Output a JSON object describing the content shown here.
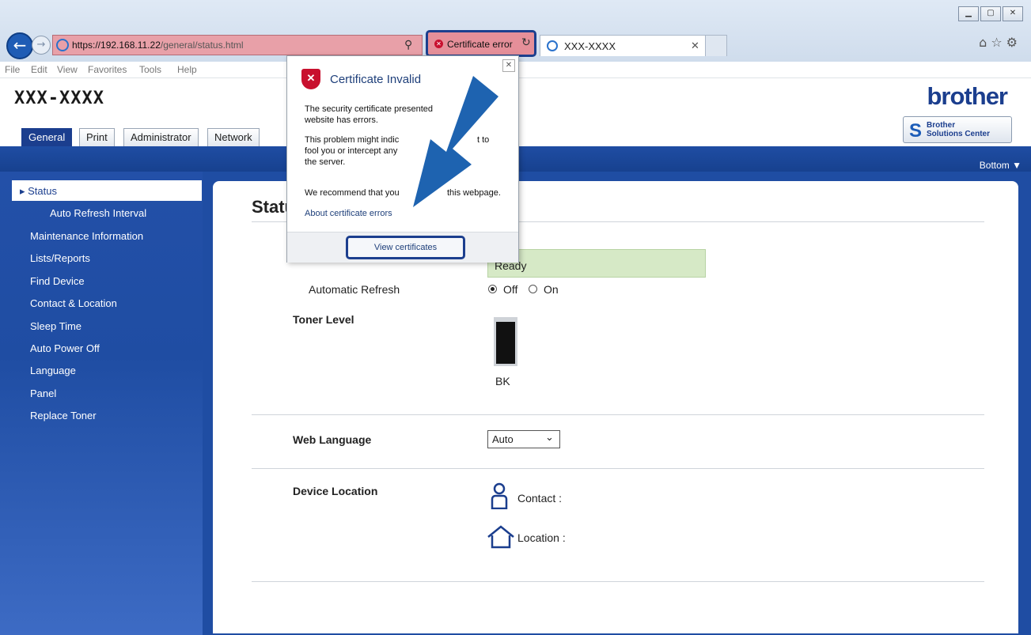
{
  "browser": {
    "url_host": "https://192.168.11.22",
    "url_path": "/general/status.html",
    "cert_error_label": "Certificate error",
    "tab_title": "XXX-XXXX",
    "menu": [
      "File",
      "Edit",
      "View",
      "Favorites",
      "Tools",
      "Help"
    ]
  },
  "header": {
    "page_title": "XXX-XXXX",
    "brand": "brother",
    "solutions_line1": "Brother",
    "solutions_line2": "Solutions Center",
    "tabs": [
      "General",
      "Print",
      "Administrator",
      "Network"
    ],
    "active_tab": "General",
    "bottom_link": "Bottom ▼"
  },
  "sidebar": {
    "selected": "Status",
    "items": [
      "Auto Refresh Interval",
      "Maintenance Information",
      "Lists/Reports",
      "Find Device",
      "Contact & Location",
      "Sleep Time",
      "Auto Power Off",
      "Language",
      "Panel",
      "Replace Toner"
    ]
  },
  "content": {
    "heading": "Statu",
    "device_status_value": "Ready",
    "auto_refresh_label": "Automatic Refresh",
    "radio_off_label": "Off",
    "radio_on_label": "On",
    "auto_refresh_selected": "Off",
    "toner_heading": "Toner Level",
    "toner_color_label": "BK",
    "toner_level_fraction": 0.95,
    "web_language_label": "Web Language",
    "web_language_value": "Auto",
    "device_location_label": "Device Location",
    "contact_label": "Contact :",
    "location_label": "Location :"
  },
  "popup": {
    "title": "Certificate Invalid",
    "close_glyph": "✕",
    "line1": "The security certificate presented",
    "line2": "website has errors.",
    "line3": "This problem might indic",
    "line3b": "t to",
    "line4": "fool you or intercept any",
    "line5": "the server.",
    "line6a": "We recommend that you",
    "line6b": "this webpage.",
    "link": "About certificate errors",
    "button": "View certificates"
  },
  "colors": {
    "brand_blue": "#1b3e8e",
    "nav_blue": "#1f4da3",
    "cert_error_bg": "#e58f99",
    "status_green": "#d6e9c6",
    "arrow_blue": "#1e63b0"
  }
}
